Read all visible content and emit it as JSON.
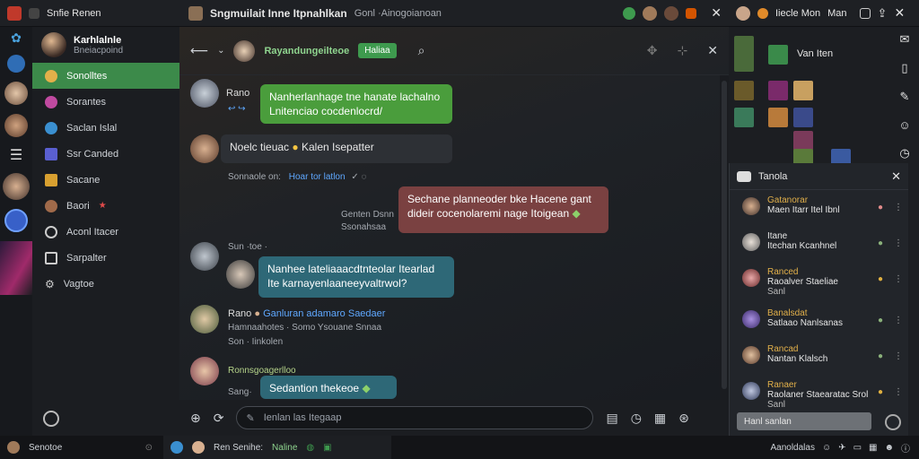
{
  "topbar": {
    "app_label": "Snfie Renen",
    "title": "Sngmuilait Inne Itpnahlkan",
    "subtitle": "Gonl ·Ainogoianoan",
    "right_label_1": "Iiecle Mon",
    "right_label_2": "Man"
  },
  "sidebar": {
    "profile_name": "Karhlalnle",
    "profile_status": "Bneiacpoind",
    "items": [
      {
        "label": "Sonolltes",
        "icon": "chat-icon",
        "active": true
      },
      {
        "label": "Sorantes",
        "icon": "people-icon",
        "active": false
      },
      {
        "label": "Saclan Islal",
        "icon": "globe-icon",
        "active": false
      },
      {
        "label": "Ssr Canded",
        "icon": "star-icon",
        "active": false
      },
      {
        "label": "Sacane",
        "icon": "calendar-icon",
        "active": false
      },
      {
        "label": "Baori",
        "icon": "bell-icon",
        "active": false
      },
      {
        "label": "Aconl Itacer",
        "icon": "clock-icon",
        "active": false
      },
      {
        "label": "Sarpalter",
        "icon": "gallery-icon",
        "active": false
      },
      {
        "label": "Vagtoe",
        "icon": "settings-icon",
        "active": false
      }
    ]
  },
  "chat": {
    "header_title": "Rayandungeilteoe",
    "header_tag": "Haliaa",
    "messages": [
      {
        "sender": "Rano",
        "text_1": "Nanherlanhage tne hanate lachalno",
        "text_2": "Lnitenciao cocdenlocrd/"
      },
      {
        "sender": "",
        "text_1": "Noelc tieuac",
        "text_2": "Kalen Isepatter"
      },
      {
        "meta": "Sonnaole on:",
        "link": "Hoar tor latlon"
      },
      {
        "meta_1": "Genten Dsnn",
        "meta_2": "Ssonahsaa",
        "text_1": "Sechane planneoder bke Hacene gant",
        "text_2": "dideir cocenolaremi nage Itoigean"
      },
      {
        "meta": "Sun ·toe ·",
        "text_1": "Nanhee lateliaaacdtnteolar Itearlad",
        "text_2": "Ite karnayenlaaneeyvaltrwol?"
      },
      {
        "sender": "Rano",
        "link": "Ganluran adamaro Saedaer",
        "line_2": "Hamnaahotes · Somo Ysouane Snnaa",
        "line_3": "Son · Iinkolen"
      },
      {
        "sender": "Ronnsgoagerlloo",
        "text_1": "Sedantion thekeoe",
        "line_2": "Sang·"
      }
    ],
    "composer_placeholder": "Ienlan las Itegaap"
  },
  "right_panel": {
    "top_label": "Van Iten",
    "members_title": "Tanola",
    "members": [
      {
        "name": "Gatanorar",
        "line": "Maen Itarr Itel Ibnl",
        "color": "#e2b04a"
      },
      {
        "name": "Itane",
        "line": "Itechan Kcanhnel",
        "color": "#e6e6e6"
      },
      {
        "name": "Ranced",
        "line": "Raoalver Staeliae",
        "extra": "Sanl",
        "color": "#e2b04a"
      },
      {
        "name": "Banalsdat",
        "line": "Satlaao Nanlsanas",
        "color": "#e2b04a"
      },
      {
        "name": "Rancad",
        "line": "Nantan Klalsch",
        "color": "#e2b04a"
      },
      {
        "name": "Ranaer",
        "line": "Raolaner Staearatac Srol",
        "extra": "Sanl",
        "color": "#e2b04a"
      }
    ],
    "search_placeholder": "Hanl sanlan"
  },
  "statusbar": {
    "left_label": "Senotoe",
    "mid_label": "Ren Senihe:",
    "mid_status": "Naline",
    "right_label": "Aanoldalas"
  },
  "colors": {
    "accent": "#3c8a4a",
    "bubble_green": "#4a9d3c",
    "bubble_red": "#7a4141",
    "bubble_teal": "#2e6877"
  }
}
